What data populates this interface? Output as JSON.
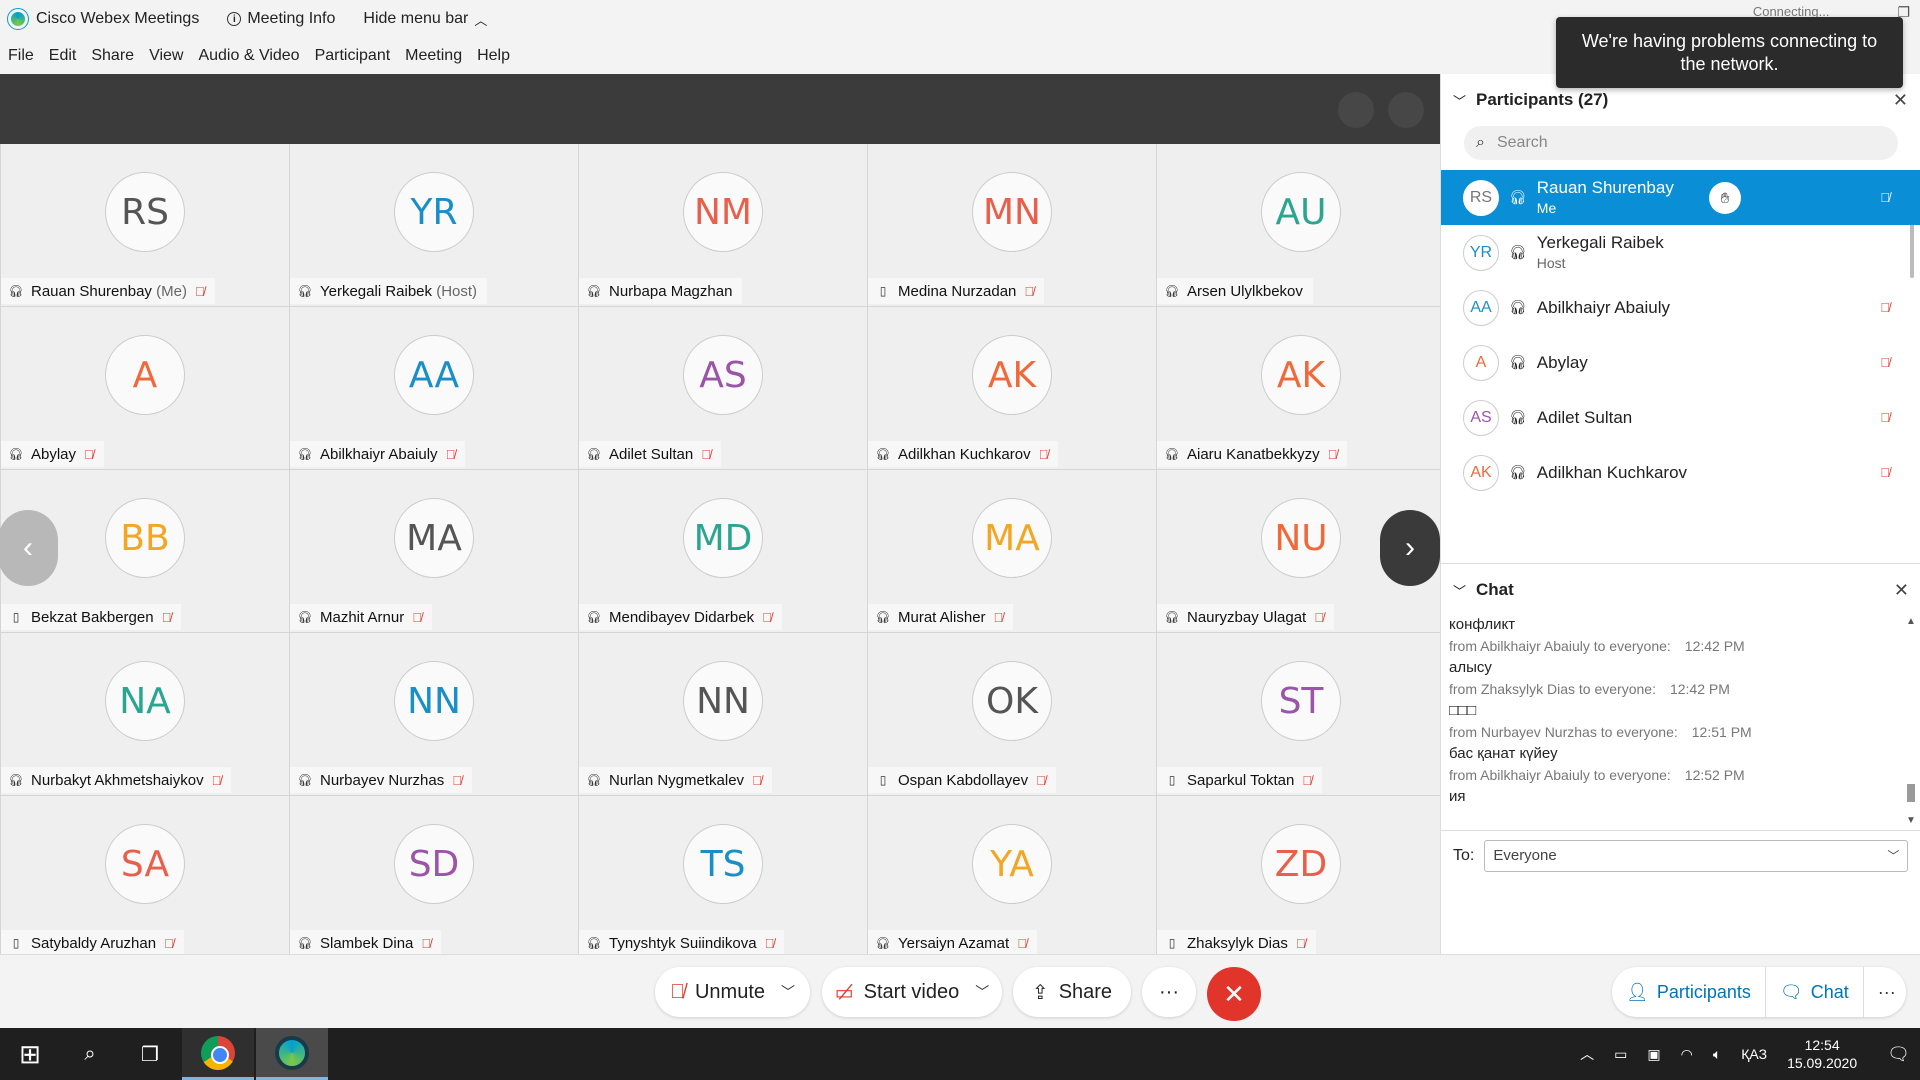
{
  "titlebar": {
    "app_name": "Cisco Webex Meetings",
    "meeting_info": "Meeting Info",
    "hide_menu": "Hide menu bar",
    "connecting": "Connecting..."
  },
  "menu": [
    "File",
    "Edit",
    "Share",
    "View",
    "Audio & Video",
    "Participant",
    "Meeting",
    "Help"
  ],
  "tooltip": "We're having problems connecting to the network.",
  "tiles": [
    {
      "initials": "RS",
      "color": "#555555",
      "name": "Rauan Shurenbay",
      "sub": "(Me)",
      "device": "headset",
      "muted": true
    },
    {
      "initials": "YR",
      "color": "#1a8fc7",
      "name": "Yerkegali Raibek",
      "sub": "(Host)",
      "device": "host",
      "muted": false
    },
    {
      "initials": "NM",
      "color": "#e8604c",
      "name": "Nurbapa Magzhan",
      "sub": "",
      "device": "headset",
      "muted": false
    },
    {
      "initials": "MN",
      "color": "#e8604c",
      "name": "Medina Nurzadan",
      "sub": "",
      "device": "phone",
      "muted": true
    },
    {
      "initials": "AU",
      "color": "#2aa58f",
      "name": "Arsen Ulylkbekov",
      "sub": "",
      "device": "headset",
      "muted": false
    },
    {
      "initials": "A",
      "color": "#f0693a",
      "name": "Abylay",
      "sub": "",
      "device": "headset",
      "muted": true
    },
    {
      "initials": "AA",
      "color": "#1a8fc7",
      "name": "Abilkhaiyr Abaiuly",
      "sub": "",
      "device": "headset",
      "muted": true
    },
    {
      "initials": "AS",
      "color": "#9b55a8",
      "name": "Adilet Sultan",
      "sub": "",
      "device": "headset",
      "muted": true
    },
    {
      "initials": "AK",
      "color": "#f0693a",
      "name": "Adilkhan Kuchkarov",
      "sub": "",
      "device": "headset",
      "muted": true
    },
    {
      "initials": "AK",
      "color": "#f0693a",
      "name": "Aiaru Kanatbekkyzy",
      "sub": "",
      "device": "headset",
      "muted": true
    },
    {
      "initials": "BB",
      "color": "#f2a623",
      "name": "Bekzat Bakbergen",
      "sub": "",
      "device": "phone",
      "muted": true
    },
    {
      "initials": "MA",
      "color": "#555555",
      "name": "Mazhit Arnur",
      "sub": "",
      "device": "headset",
      "muted": true
    },
    {
      "initials": "MD",
      "color": "#2aa58f",
      "name": "Mendibayev Didarbek",
      "sub": "",
      "device": "headset",
      "muted": true
    },
    {
      "initials": "MA",
      "color": "#f2a623",
      "name": "Murat Alisher",
      "sub": "",
      "device": "headset",
      "muted": true
    },
    {
      "initials": "NU",
      "color": "#f0693a",
      "name": "Nauryzbay Ulagat",
      "sub": "",
      "device": "headset",
      "muted": true
    },
    {
      "initials": "NA",
      "color": "#2aa58f",
      "name": "Nurbakyt Akhmetshaiykov",
      "sub": "",
      "device": "headset",
      "muted": true
    },
    {
      "initials": "NN",
      "color": "#1a8fc7",
      "name": "Nurbayev Nurzhas",
      "sub": "",
      "device": "headset",
      "muted": true
    },
    {
      "initials": "NN",
      "color": "#555555",
      "name": "Nurlan Nygmetkalev",
      "sub": "",
      "device": "headset",
      "muted": true
    },
    {
      "initials": "OK",
      "color": "#555555",
      "name": "Ospan Kabdollayev",
      "sub": "",
      "device": "phone",
      "muted": true
    },
    {
      "initials": "ST",
      "color": "#9b55a8",
      "name": "Saparkul Toktan",
      "sub": "",
      "device": "phone",
      "muted": true
    },
    {
      "initials": "SA",
      "color": "#e8604c",
      "name": "Satybaldy Aruzhan",
      "sub": "",
      "device": "phone",
      "muted": true
    },
    {
      "initials": "SD",
      "color": "#9b55a8",
      "name": "Slambek Dina",
      "sub": "",
      "device": "headset",
      "muted": true
    },
    {
      "initials": "TS",
      "color": "#1a8fc7",
      "name": "Tynyshtyk Suiindikova",
      "sub": "",
      "device": "headset",
      "muted": true
    },
    {
      "initials": "YA",
      "color": "#f2a623",
      "name": "Yersaiyn Azamat",
      "sub": "",
      "device": "headset",
      "muted": true
    },
    {
      "initials": "ZD",
      "color": "#e8604c",
      "name": "Zhaksylyk Dias",
      "sub": "",
      "device": "phone",
      "muted": true
    }
  ],
  "controls": {
    "unmute": "Unmute",
    "start_video": "Start video",
    "share": "Share",
    "more": "···",
    "participants": "Participants",
    "chat": "Chat"
  },
  "participants_panel": {
    "title": "Participants (27)",
    "search_placeholder": "Search",
    "rows": [
      {
        "initials": "RS",
        "name": "Rauan Shurenbay",
        "sub": "Me",
        "color": "#777777",
        "selected": true
      },
      {
        "initials": "YR",
        "name": "Yerkegali Raibek",
        "sub": "Host",
        "color": "#1a8fc7",
        "selected": false
      },
      {
        "initials": "AA",
        "name": "Abilkhaiyr Abaiuly",
        "sub": "",
        "color": "#1a8fc7",
        "selected": false
      },
      {
        "initials": "A",
        "name": "Abylay",
        "sub": "",
        "color": "#f0693a",
        "selected": false
      },
      {
        "initials": "AS",
        "name": "Adilet Sultan",
        "sub": "",
        "color": "#9b55a8",
        "selected": false
      },
      {
        "initials": "AK",
        "name": "Adilkhan Kuchkarov",
        "sub": "",
        "color": "#f0693a",
        "selected": false
      },
      {
        "initials": "AK",
        "name": "Aiaru Kanatbekkyzy",
        "sub": "",
        "color": "#f0693a",
        "selected": false
      }
    ]
  },
  "chat_panel": {
    "title": "Chat",
    "messages": [
      {
        "text": "конфликт"
      },
      {
        "from": "from Abilkhaiyr Abaiuly to everyone:",
        "time": "12:42 PM",
        "text": "алысу"
      },
      {
        "from": "from Zhaksylyk Dias to everyone:",
        "time": "12:42 PM",
        "text": "□□□"
      },
      {
        "from": "from Nurbayev Nurzhas to everyone:",
        "time": "12:51 PM",
        "text": "бас қанат күйеу"
      },
      {
        "from": "from Abilkhaiyr Abaiuly to everyone:",
        "time": "12:52 PM",
        "text": "ия"
      }
    ],
    "to_label": "To:",
    "to_value": "Everyone"
  },
  "taskbar": {
    "lang": "ҚАЗ",
    "time": "12:54",
    "date": "15.09.2020"
  }
}
